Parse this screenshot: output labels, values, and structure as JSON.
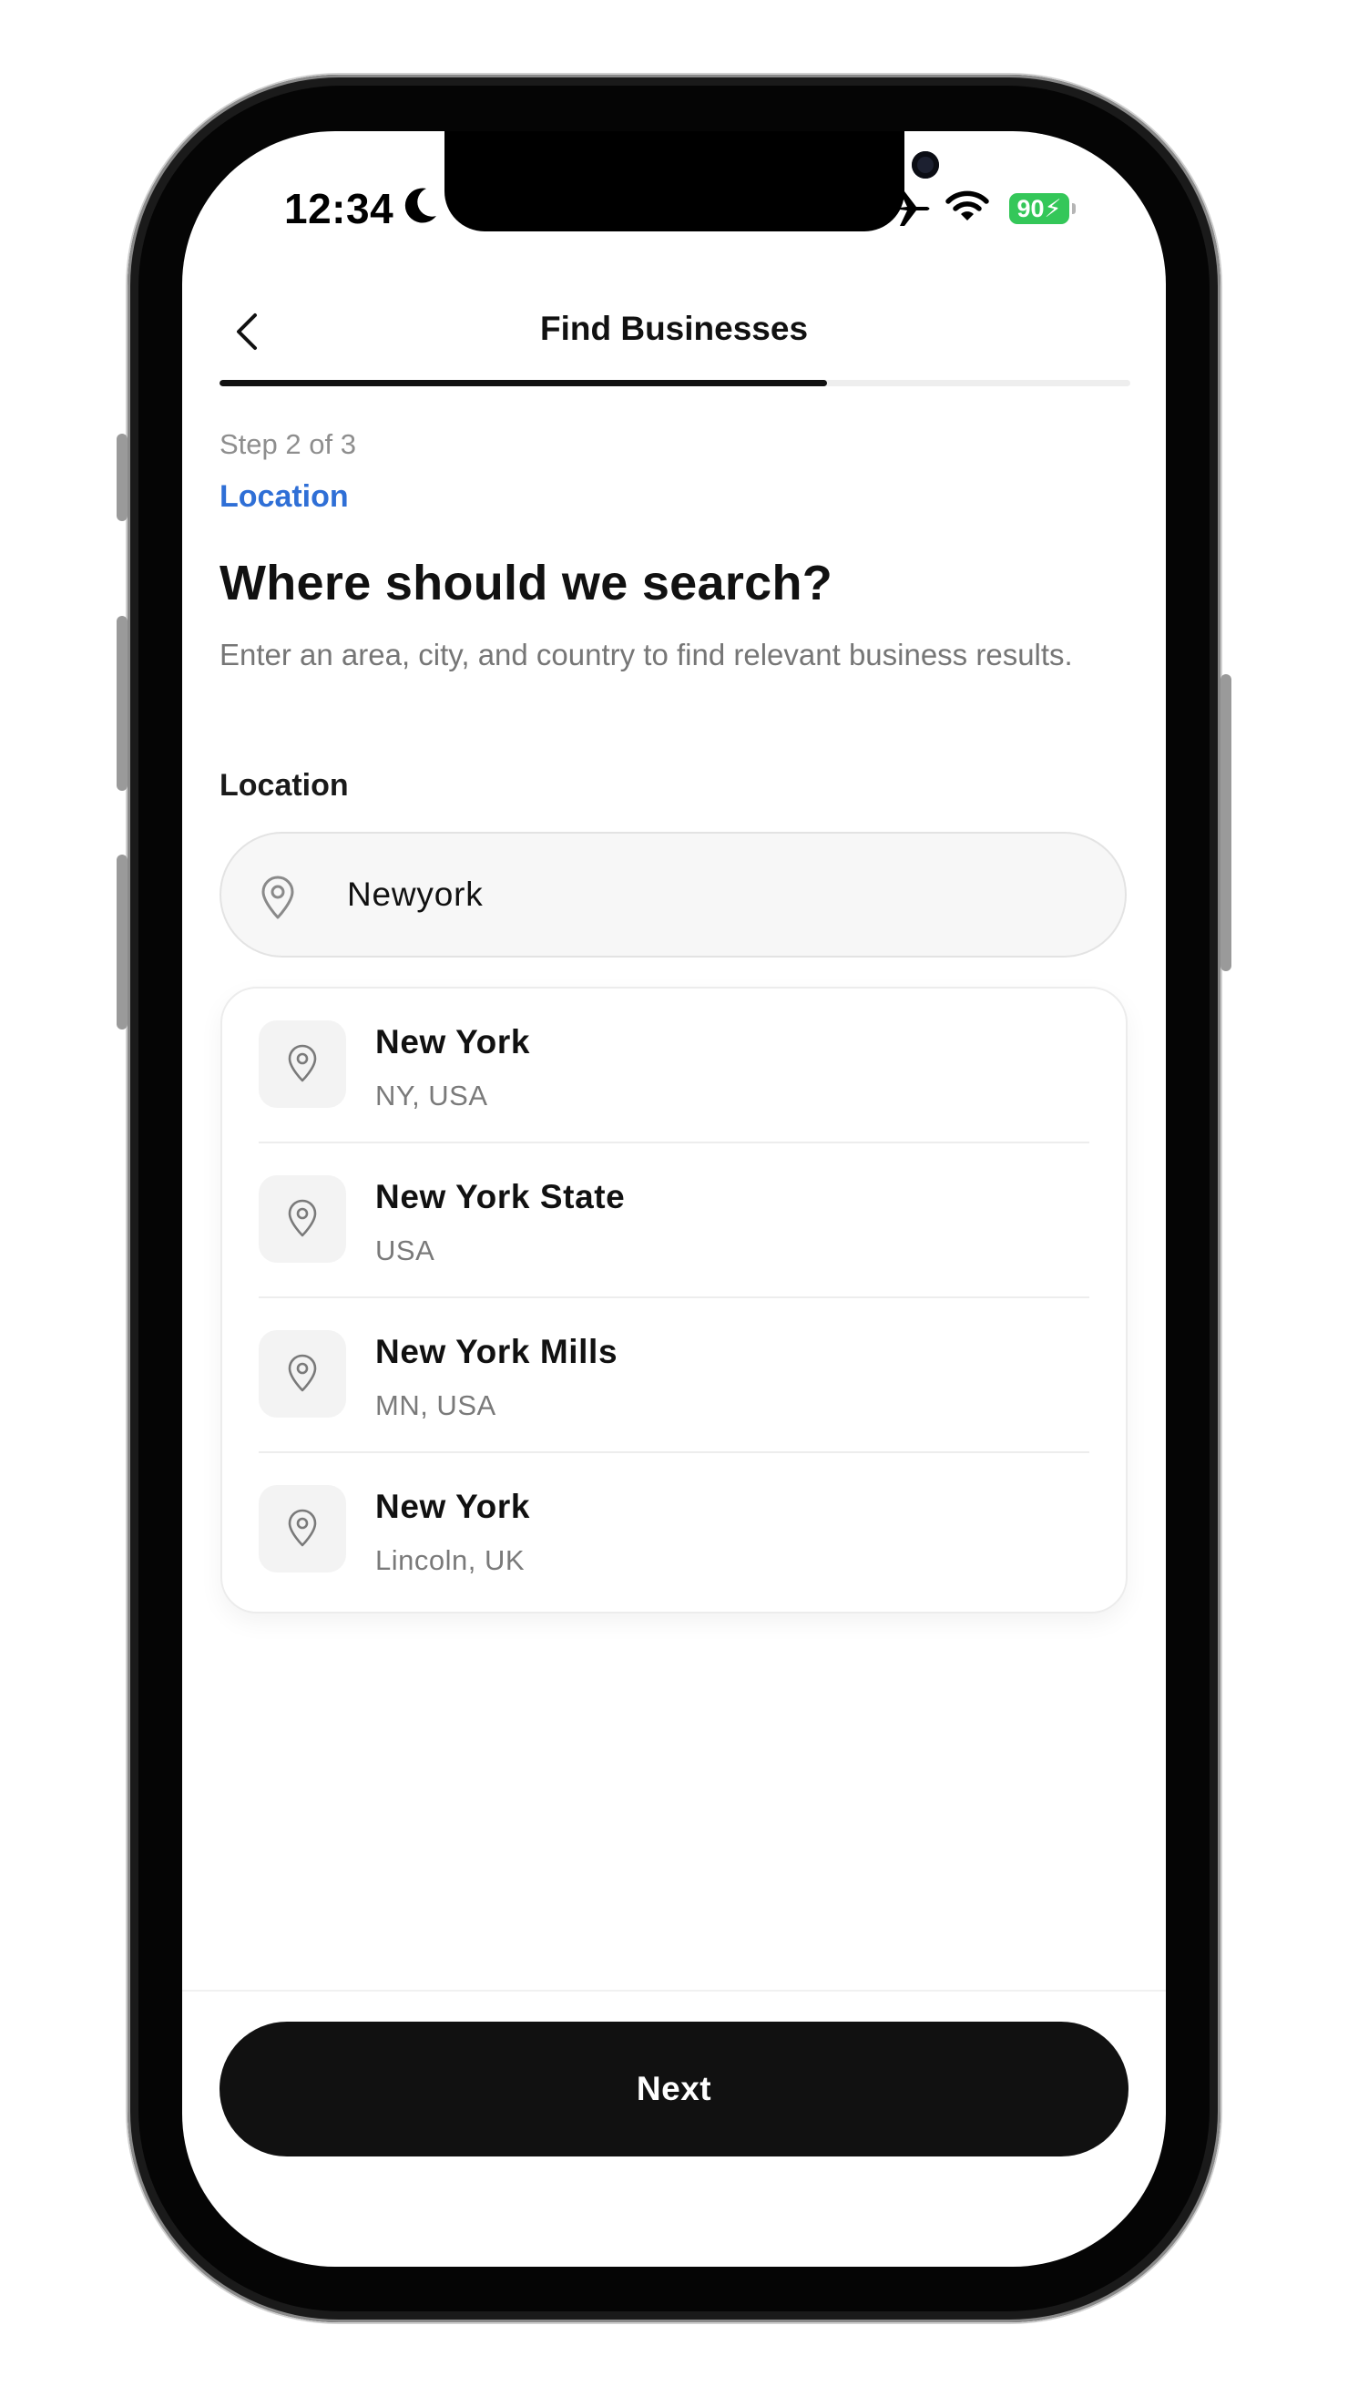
{
  "status_bar": {
    "time": "12:34",
    "battery_percent": "90",
    "icons": [
      "moon-icon",
      "airplane-icon",
      "wifi-icon",
      "battery-icon"
    ],
    "battery_color": "#34c759"
  },
  "header": {
    "title": "Find Businesses",
    "back_icon": "chevron-left-icon"
  },
  "progress": {
    "current_step": 2,
    "total_steps": 3,
    "fraction": 0.667
  },
  "step": {
    "label": "Step 2 of 3",
    "name": "Location",
    "accent_color": "#2f6fd6"
  },
  "main": {
    "heading": "Where should we search?",
    "subtitle": "Enter an area, city, and country to find relevant business results.",
    "field_label": "Location",
    "search": {
      "value": "Newyork",
      "icon": "map-pin-icon"
    },
    "suggestions": [
      {
        "title": "New York",
        "subtitle": "NY, USA",
        "icon": "map-pin-icon"
      },
      {
        "title": "New York State",
        "subtitle": "USA",
        "icon": "map-pin-icon"
      },
      {
        "title": "New York Mills",
        "subtitle": "MN, USA",
        "icon": "map-pin-icon"
      },
      {
        "title": "New York",
        "subtitle": "Lincoln, UK",
        "icon": "map-pin-icon"
      }
    ]
  },
  "footer": {
    "next_label": "Next"
  }
}
